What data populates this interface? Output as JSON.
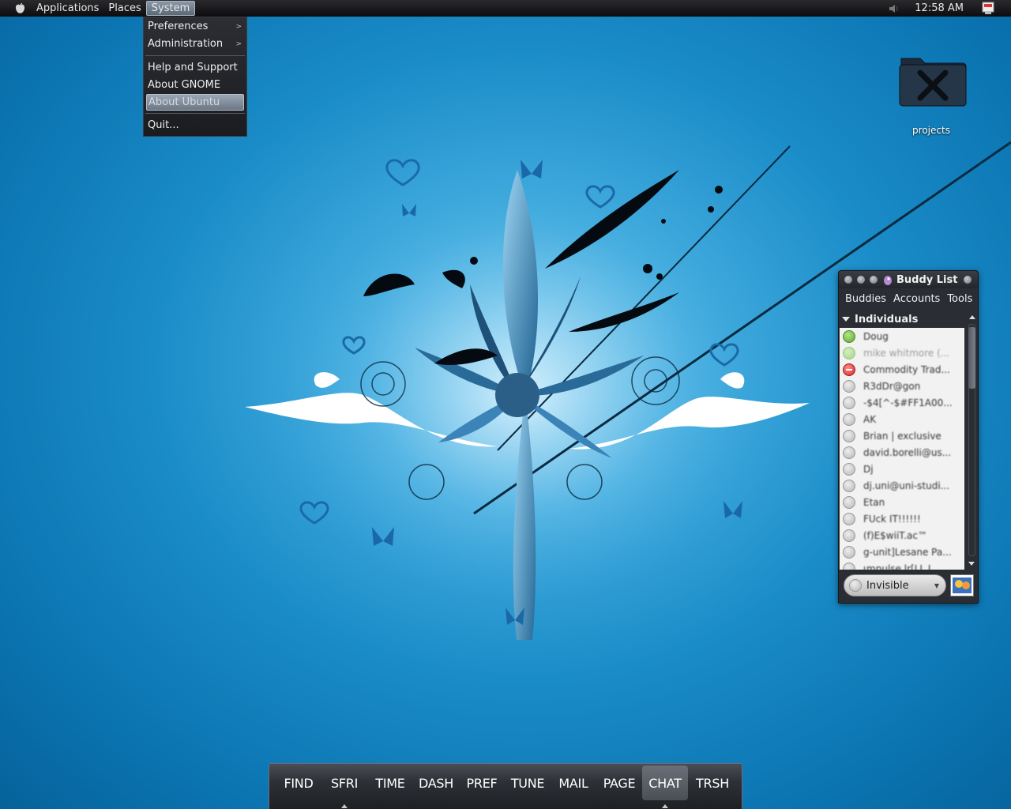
{
  "top_panel": {
    "menus": [
      "Applications",
      "Places",
      "System"
    ],
    "active_menu": "System",
    "clock": "12:58 AM",
    "icons": [
      "ubuntu-logo-icon",
      "volume-icon",
      "user-switch-icon"
    ]
  },
  "system_menu": {
    "items": [
      {
        "label": "Preferences",
        "submenu": true
      },
      {
        "label": "Administration",
        "submenu": true
      },
      {
        "label": "Help and Support",
        "submenu": false
      },
      {
        "label": "About GNOME",
        "submenu": false
      },
      {
        "label": "About Ubuntu",
        "submenu": false,
        "highlighted": true
      },
      {
        "label": "Quit...",
        "submenu": false
      }
    ],
    "submenu_arrow": ">"
  },
  "desktop": {
    "icon_label": "projects",
    "icon": "tools-folder-icon"
  },
  "buddy_list": {
    "title": "Buddy List",
    "menu": [
      "Buddies",
      "Accounts",
      "Tools"
    ],
    "group": "Individuals",
    "buddies": [
      {
        "name": "Doug",
        "status": "available"
      },
      {
        "name": "mike whitmore (...",
        "status": "available-idle"
      },
      {
        "name": "Commodity Trad...",
        "status": "busy"
      },
      {
        "name": "R3dDr@gon",
        "status": "offline"
      },
      {
        "name": "-$4[^-$#FF1A00...",
        "status": "offline"
      },
      {
        "name": "AK",
        "status": "offline"
      },
      {
        "name": "Brian | exclusive",
        "status": "offline"
      },
      {
        "name": "david.borelli@us...",
        "status": "offline"
      },
      {
        "name": "Dj",
        "status": "offline"
      },
      {
        "name": "dj.uni@uni-studi...",
        "status": "offline"
      },
      {
        "name": "Etan",
        "status": "offline"
      },
      {
        "name": "FUck IT!!!!!!",
        "status": "offline"
      },
      {
        "name": "(f)E$wiiT.ac™",
        "status": "offline"
      },
      {
        "name": "g-unit]Lesane Pa...",
        "status": "offline"
      },
      {
        "name": "ιmpulse lr[LL.L",
        "status": "offline"
      }
    ],
    "status_selector": "Invisible"
  },
  "dock": {
    "items": [
      {
        "label": "FIND",
        "marker": false,
        "active": false
      },
      {
        "label": "SFRI",
        "marker": true,
        "active": false
      },
      {
        "label": "TIME",
        "marker": false,
        "active": false
      },
      {
        "label": "DASH",
        "marker": false,
        "active": false
      },
      {
        "label": "PREF",
        "marker": false,
        "active": false
      },
      {
        "label": "TUNE",
        "marker": false,
        "active": false
      },
      {
        "label": "MAIL",
        "marker": false,
        "active": false
      },
      {
        "label": "PAGE",
        "marker": false,
        "active": false
      },
      {
        "label": "CHAT",
        "marker": true,
        "active": true
      },
      {
        "label": "TRSH",
        "marker": false,
        "active": false
      }
    ]
  },
  "colors": {
    "panel": "#111114",
    "wallpaper_accent": "#1a8cc8",
    "highlight": "#7c8896"
  }
}
